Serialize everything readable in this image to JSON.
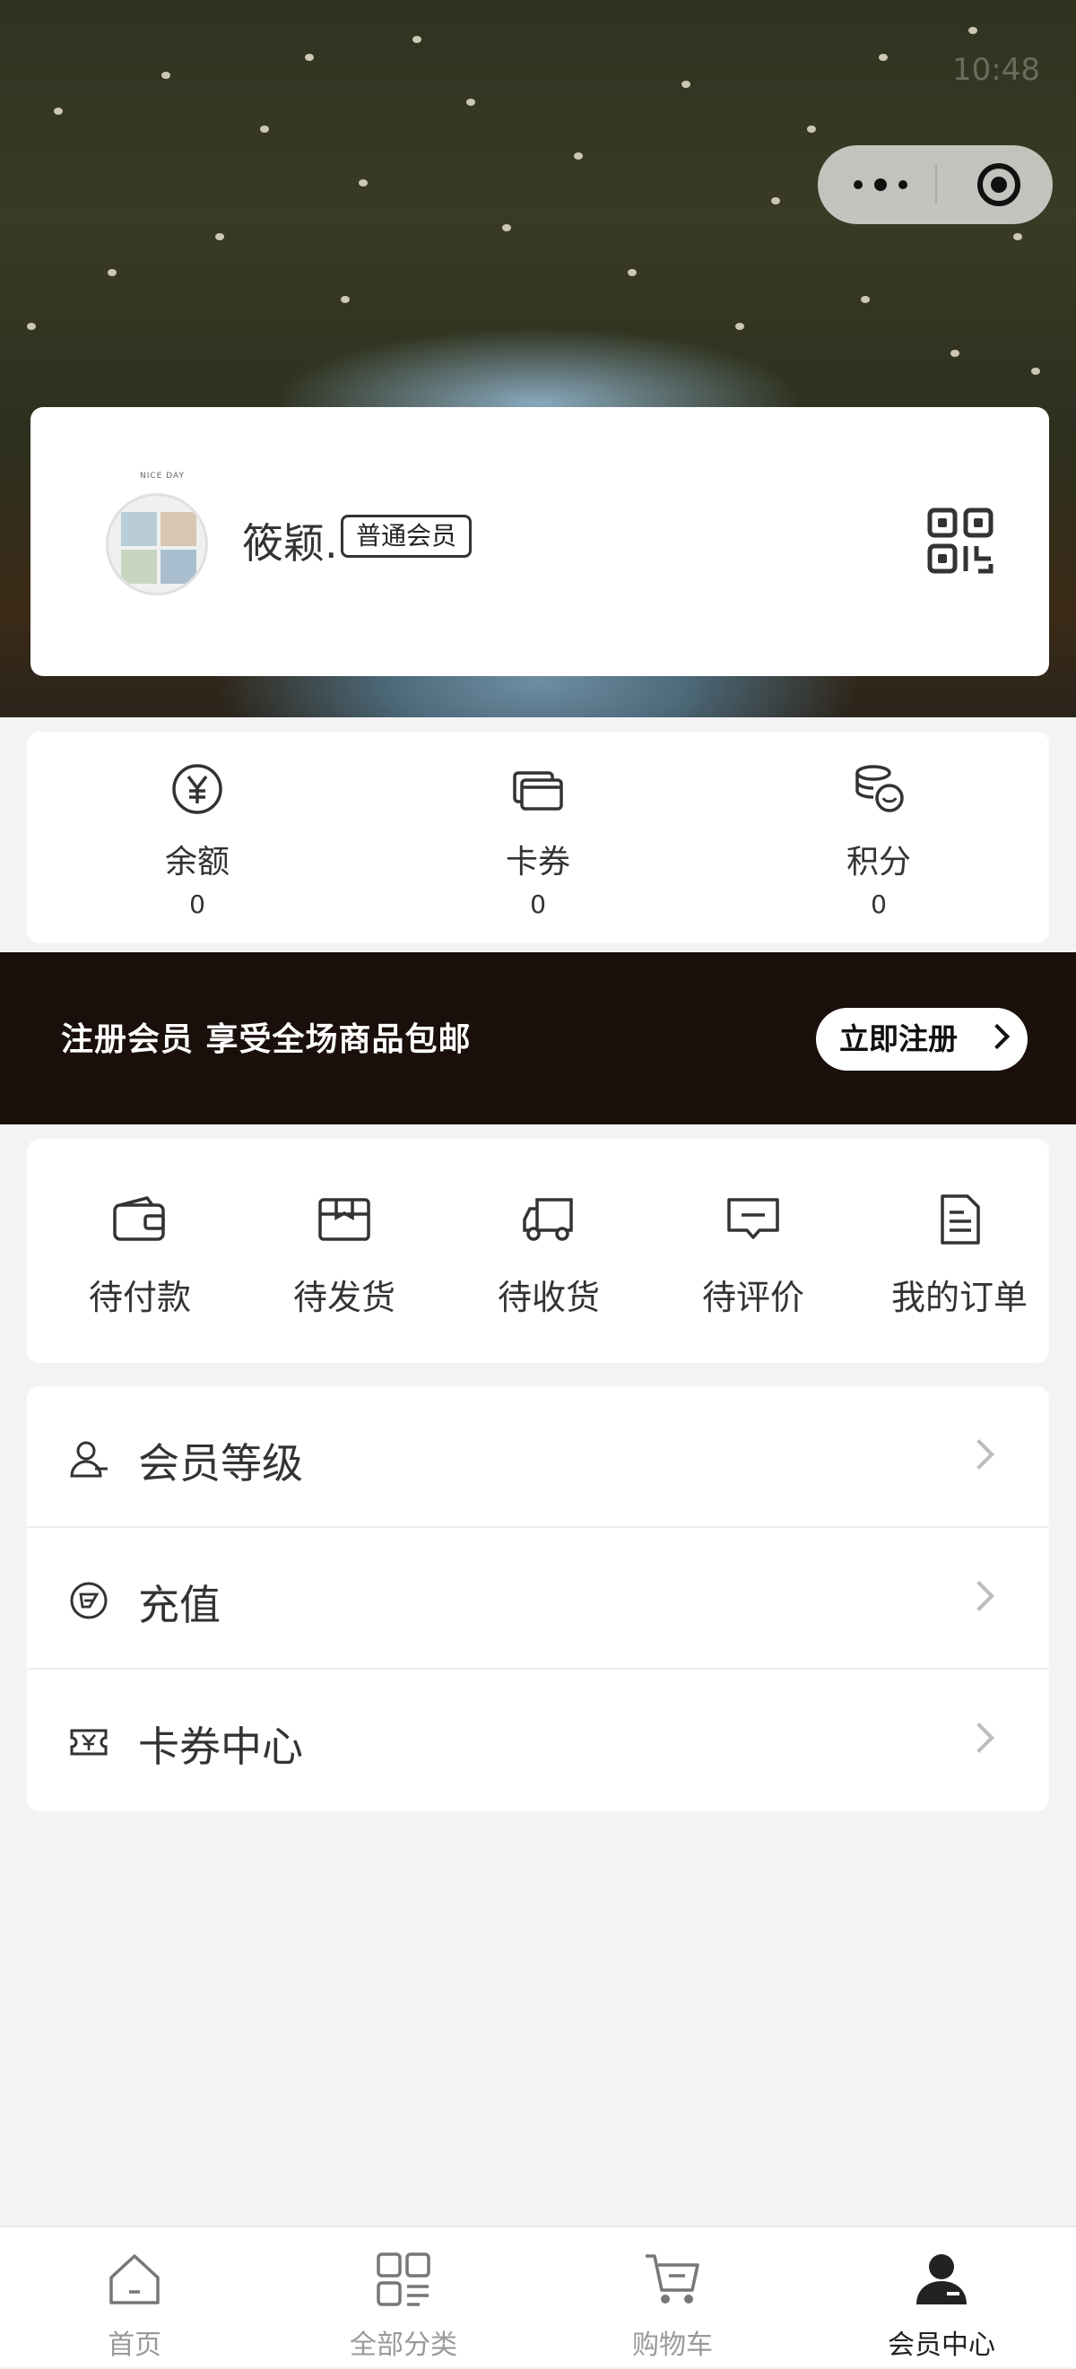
{
  "profile": {
    "username": "筱颖.",
    "member_level": "普通会员",
    "avatar_caption": "NICE DAY"
  },
  "wallet": [
    {
      "icon": "yuan-icon",
      "label": "余额",
      "value": "0"
    },
    {
      "icon": "card-icon",
      "label": "卡券",
      "value": "0"
    },
    {
      "icon": "coins-icon",
      "label": "积分",
      "value": "0"
    }
  ],
  "banner": {
    "text": "注册会员 享受全场商品包邮",
    "button_label": "立即注册"
  },
  "orders": [
    {
      "icon": "wallet-icon",
      "label": "待付款"
    },
    {
      "icon": "box-icon",
      "label": "待发货"
    },
    {
      "icon": "truck-icon",
      "label": "待收货"
    },
    {
      "icon": "comment-icon",
      "label": "待评价"
    },
    {
      "icon": "document-icon",
      "label": "我的订单"
    }
  ],
  "menu": [
    {
      "icon": "user-level-icon",
      "label": "会员等级"
    },
    {
      "icon": "recharge-icon",
      "label": "充值"
    },
    {
      "icon": "ticket-icon",
      "label": "卡券中心"
    }
  ],
  "tabbar": [
    {
      "icon": "home-icon",
      "label": "首页",
      "active": false
    },
    {
      "icon": "category-icon",
      "label": "全部分类",
      "active": false
    },
    {
      "icon": "cart-icon",
      "label": "购物车",
      "active": false
    },
    {
      "icon": "member-icon",
      "label": "会员中心",
      "active": true
    }
  ],
  "status_bar": {
    "time": "10:48"
  }
}
